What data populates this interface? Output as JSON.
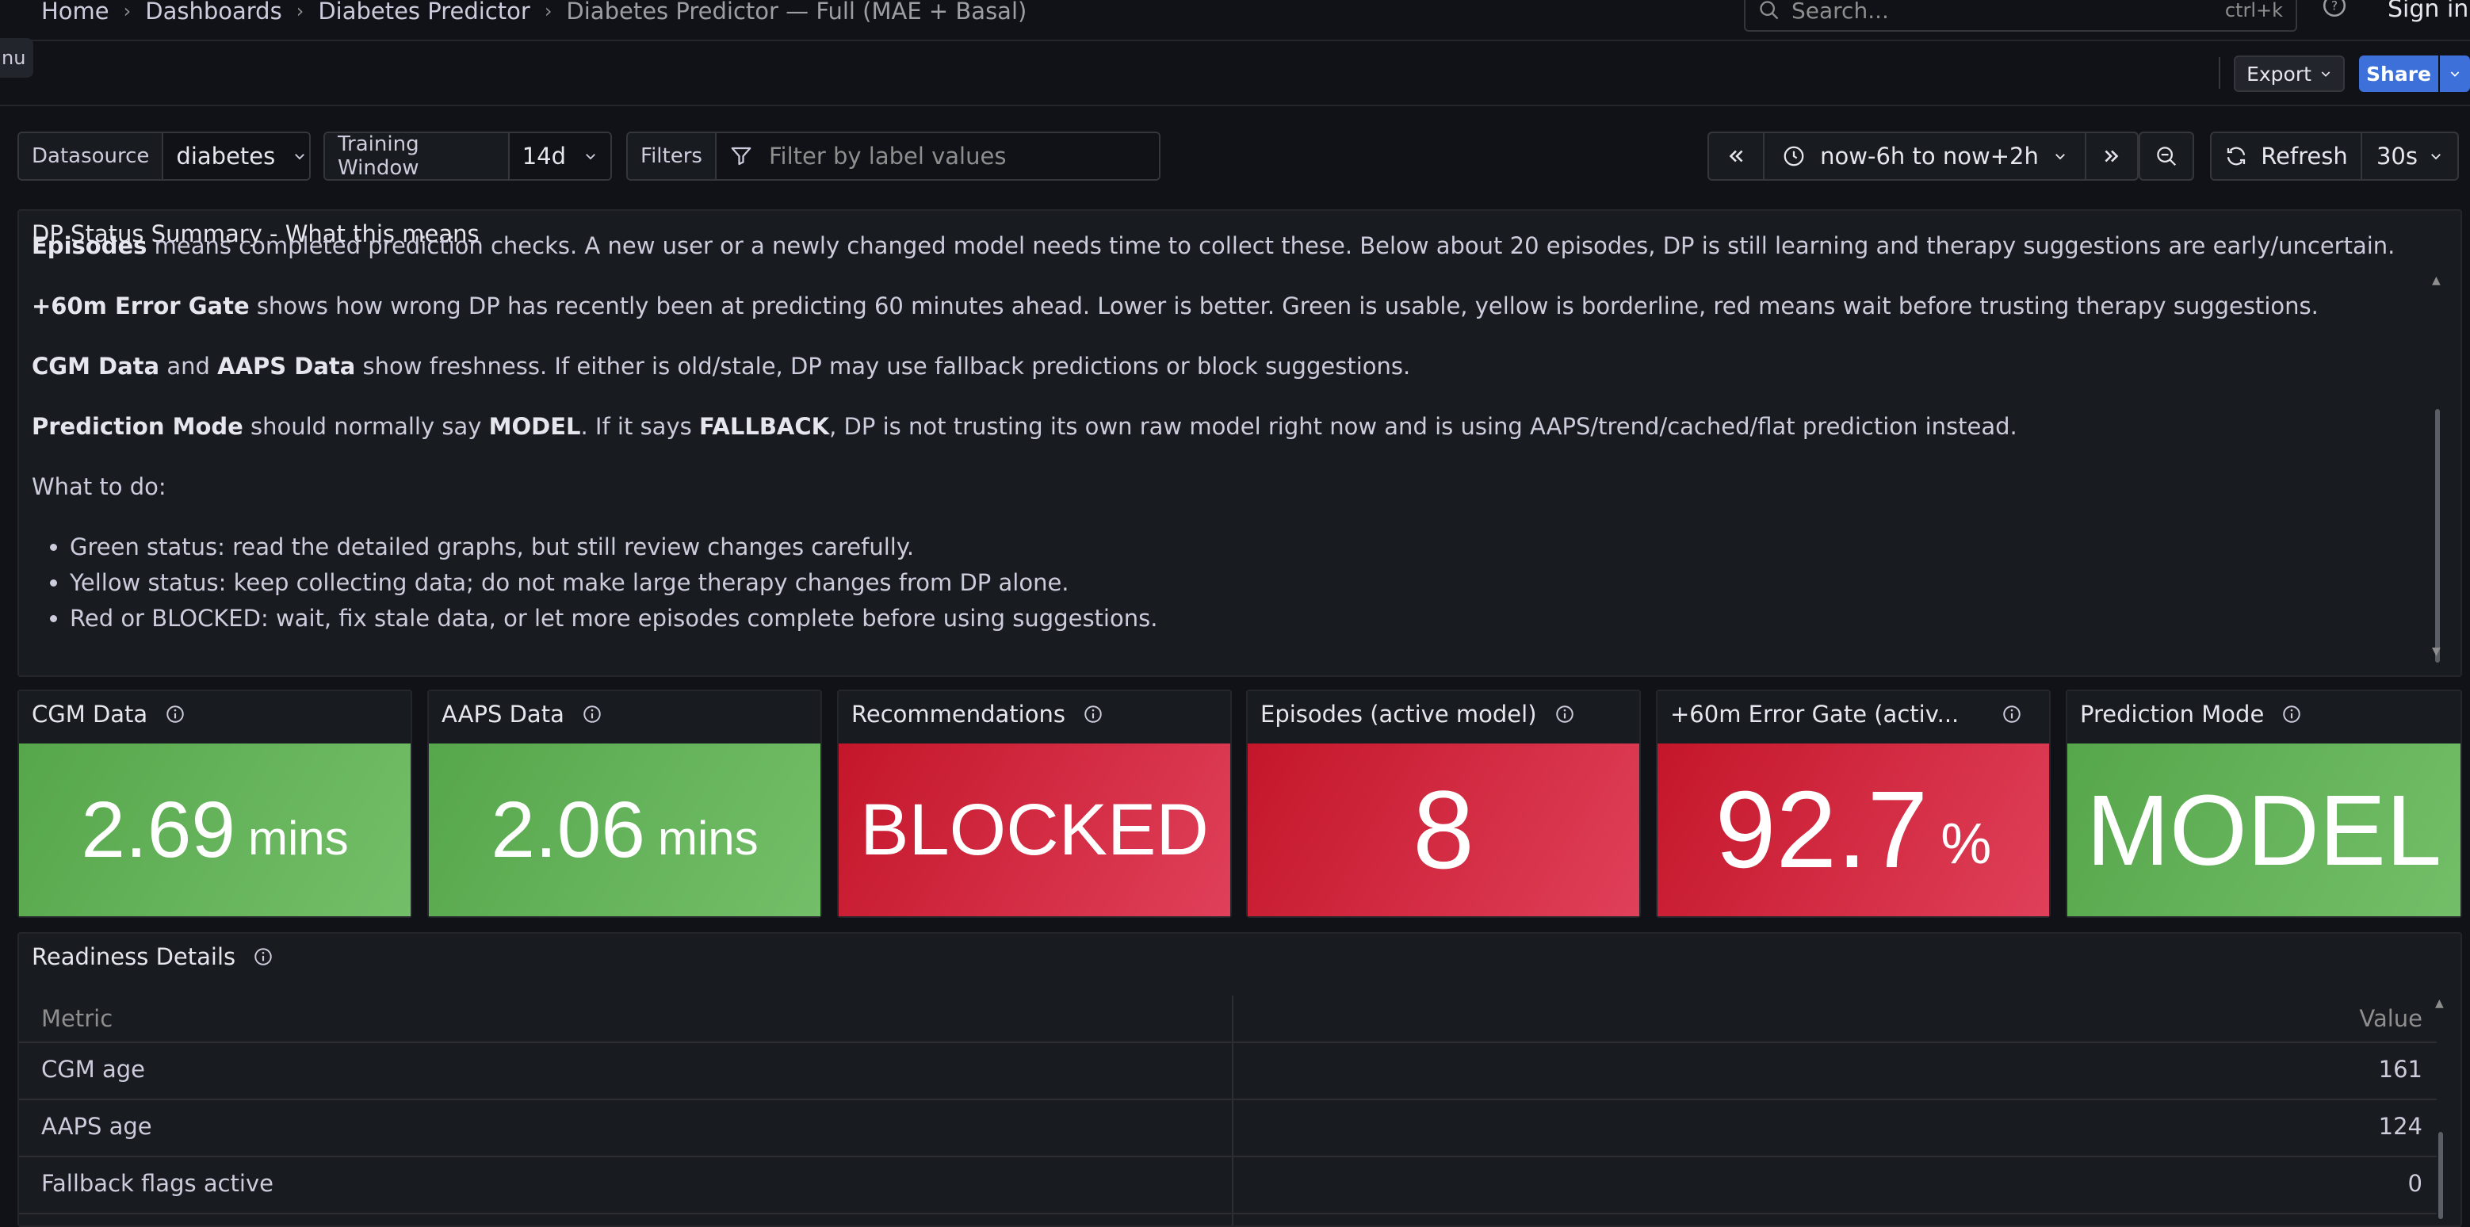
{
  "breadcrumb": {
    "items": [
      "Home",
      "Dashboards",
      "Diabetes Predictor"
    ],
    "current": "Diabetes Predictor — Full (MAE + Basal)"
  },
  "search": {
    "placeholder": "Search...",
    "shortcut": "ctrl+k"
  },
  "auth": {
    "signin_label": "Sign in"
  },
  "menu_tab_label": "nu",
  "toolbar": {
    "export_label": "Export",
    "share_label": "Share"
  },
  "variables": [
    {
      "label": "Datasource",
      "value": "diabetes"
    },
    {
      "label": "Training Window",
      "value": "14d"
    },
    {
      "label": "Filters",
      "placeholder": "Filter by label values"
    }
  ],
  "time": {
    "range": "now-6h to now+2h",
    "refresh_label": "Refresh",
    "interval": "30s"
  },
  "summary": {
    "title": "DP Status Summary - What this means",
    "p1": {
      "bold": "Episodes",
      "text": " means completed prediction checks. A new user or a newly changed model needs time to collect these. Below about 20 episodes, DP is still learning and therapy suggestions are early/uncertain."
    },
    "p2": {
      "bold": "+60m Error Gate",
      "text": " shows how wrong DP has recently been at predicting 60 minutes ahead. Lower is better. Green is usable, yellow is borderline, red means wait before trusting therapy suggestions."
    },
    "p3": {
      "bold1": "CGM Data",
      "mid": " and ",
      "bold2": "AAPS Data",
      "text": " show freshness. If either is old/stale, DP may use fallback predictions or block suggestions."
    },
    "p4": {
      "bold1": "Prediction Mode",
      "mid1": " should normally say ",
      "bold2": "MODEL",
      "mid2": ". If it says ",
      "bold3": "FALLBACK",
      "text": ", DP is not trusting its own raw model right now and is using AAPS/trend/cached/flat prediction instead."
    },
    "what_to_do": "What to do:",
    "bullets": [
      "Green status: read the detailed graphs, but still review changes carefully.",
      "Yellow status: keep collecting data; do not make large therapy changes from DP alone.",
      "Red or BLOCKED: wait, fix stale data, or let more episodes complete before using suggestions."
    ]
  },
  "stats": [
    {
      "title": "CGM Data",
      "value": "2.69",
      "unit": "mins",
      "color": "#73bf69"
    },
    {
      "title": "AAPS Data",
      "value": "2.06",
      "unit": "mins",
      "color": "#73bf69"
    },
    {
      "title": "Recommendations",
      "value": "BLOCKED",
      "color": "#e02f44"
    },
    {
      "title": "Episodes (active model)",
      "value": "8",
      "color": "#e02f44"
    },
    {
      "title": "+60m Error Gate (activ...",
      "value": "92.7",
      "unit": "%",
      "color": "#e02f44"
    },
    {
      "title": "Prediction Mode",
      "value": "MODEL",
      "color": "#73bf69"
    }
  ],
  "readiness": {
    "title": "Readiness Details",
    "columns": [
      "Metric",
      "Value"
    ],
    "rows": [
      {
        "metric": "CGM age",
        "value": "161"
      },
      {
        "metric": "AAPS age",
        "value": "124"
      },
      {
        "metric": "Fallback flags active",
        "value": "0"
      }
    ]
  },
  "colors": {
    "background": "#111217",
    "panel": "#181b1f",
    "accent": "#3d71d9",
    "ok": "#73bf69",
    "critical": "#e02f44"
  }
}
